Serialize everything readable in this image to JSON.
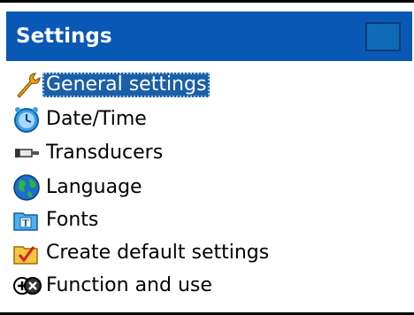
{
  "window": {
    "title": "Settings"
  },
  "menu": {
    "items": [
      {
        "label": "General settings",
        "icon": "wrench-icon",
        "selected": true
      },
      {
        "label": "Date/Time",
        "icon": "clock-icon",
        "selected": false
      },
      {
        "label": "Transducers",
        "icon": "transducer-icon",
        "selected": false
      },
      {
        "label": "Language",
        "icon": "globe-icon",
        "selected": false
      },
      {
        "label": "Fonts",
        "icon": "font-folder-icon",
        "selected": false
      },
      {
        "label": "Create default settings",
        "icon": "checkbox-folder-icon",
        "selected": false
      },
      {
        "label": "Function and use",
        "icon": "function-icon",
        "selected": false
      }
    ]
  },
  "colors": {
    "title_bar": "#0a58b5",
    "selection": "#1a5fa8"
  }
}
